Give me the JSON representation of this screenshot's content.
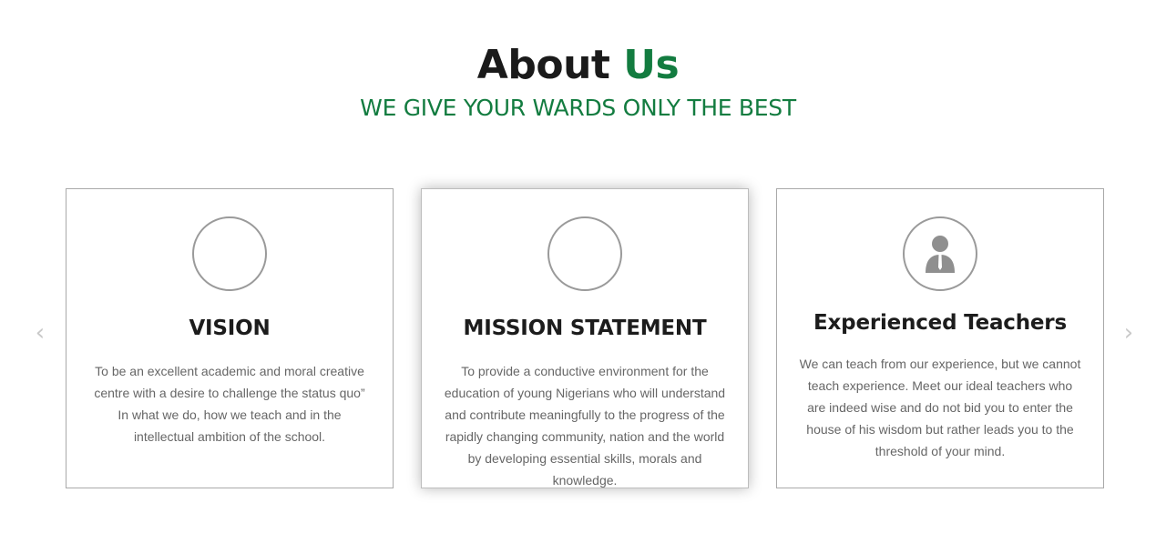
{
  "section": {
    "title_main": "About",
    "title_accent": "Us",
    "subtitle": "WE GIVE YOUR WARDS ONLY THE BEST"
  },
  "carousel": {
    "prev_icon": "‹",
    "next_icon": "›",
    "cards": [
      {
        "icon": "empty-circle",
        "title": "VISION",
        "text": "To be an excellent academic and moral creative centre with a desire to challenge the status quo” In what we do, how we teach and in the intellectual ambition of the school."
      },
      {
        "icon": "empty-circle",
        "title": "MISSION STATEMENT",
        "text": "To provide a conductive environment for the education of young Nigerians who will understand and contribute meaningfully to the progress of the rapidly changing community, nation and the world by developing essential skills, morals and knowledge."
      },
      {
        "icon": "teacher-icon",
        "title": "Experienced Teachers",
        "text": "We can teach from our experience, but we cannot teach experience. Meet our ideal teachers who are indeed wise and do not bid you to enter the house of his wisdom but rather leads you to the threshold of your mind."
      }
    ]
  },
  "colors": {
    "accent": "#137c40",
    "heading": "#1a1a1a",
    "body_text": "#666666",
    "border": "#a9a9a9",
    "icon_gray": "#8f8f8f"
  }
}
